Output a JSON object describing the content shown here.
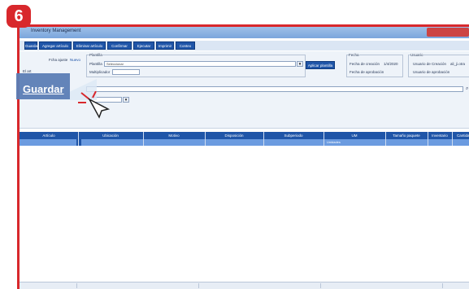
{
  "step_number": "6",
  "window": {
    "title": "Inventory Management"
  },
  "toolbar": {
    "buttons": [
      "Guardar",
      "Agregar artículo",
      "Eliminar artículo",
      "Confirmar",
      "Ejecutar",
      "Imprimir",
      "Conteo"
    ]
  },
  "callout": {
    "label": "Guardar"
  },
  "panel": {
    "fecha_ajuste_label": "Fcha ajuste",
    "fecha_ajuste_value": "Nuevo",
    "plantilla_group": "Plantilla",
    "plantilla_label": "Plantilla",
    "plantilla_value": "Seleccionar",
    "multiplicador_label": "Multiplicador",
    "aplicar_button": "Aplicar plantilla",
    "fecha_group": "Fecha",
    "fecha_creacion_label": "Fecha de creación",
    "fecha_creacion_value": "1/4/2020",
    "fecha_aprobacion_label": "Fecha de aprobación",
    "usuario_group": "Usuario",
    "usuario_creacion_label": "Usuario de Creación",
    "usuario_creacion_value": "ali_ji.otra",
    "usuario_aprobacion_label": "Usuario de aprobación",
    "left_cut_label": "El art",
    "comment_label": "Com"
  },
  "grid": {
    "columns": [
      "Artículo",
      "Ubicación",
      "Motivo",
      "Disposición",
      "Subperiodo",
      "UM",
      "Tamaño paquete",
      "Inventario",
      "Cantidad"
    ],
    "row": {
      "um": "Unidades"
    }
  }
}
